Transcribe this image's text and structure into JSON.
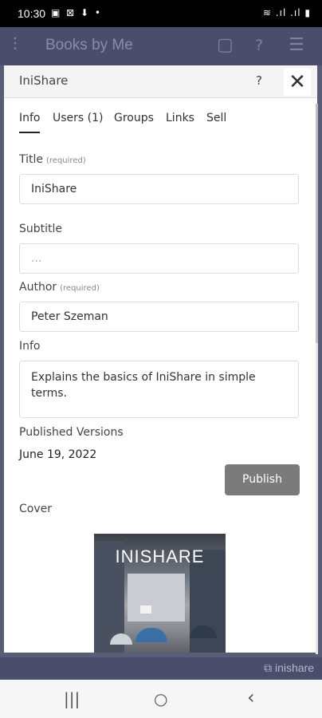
{
  "status": {
    "time": "10:30",
    "left_icons": "▣ ⊠ ⬇ •",
    "right_icons": "≋ .ıl .ıl ▮"
  },
  "app": {
    "title": "Books by Me",
    "filter_icon": "⫶",
    "clipboard_icon": "▢",
    "help_icon": "?",
    "menu_icon": "☰"
  },
  "modal": {
    "title": "IniShare",
    "help": "?",
    "close": "✕",
    "tabs": [
      "Info",
      "Users (1)",
      "Groups",
      "Links",
      "Sell"
    ],
    "title_label": "Title",
    "title_req": "(required)",
    "title_value": "IniShare",
    "subtitle_label": "Subtitle",
    "subtitle_placeholder": "...",
    "author_label": "Author",
    "author_req": "(required)",
    "author_value": "Peter Szeman",
    "info_label": "Info",
    "info_value": "Explains the basics of IniShare in simple terms.",
    "published_label": "Published Versions",
    "published_date": "June 19, 2022",
    "publish_button": "Publish",
    "cover_label": "Cover",
    "cover_title": "INISHARE"
  },
  "footer": {
    "logo": "⧉ inishare"
  },
  "navbar": {
    "recents": "|||",
    "home": "○",
    "back": "‹"
  }
}
